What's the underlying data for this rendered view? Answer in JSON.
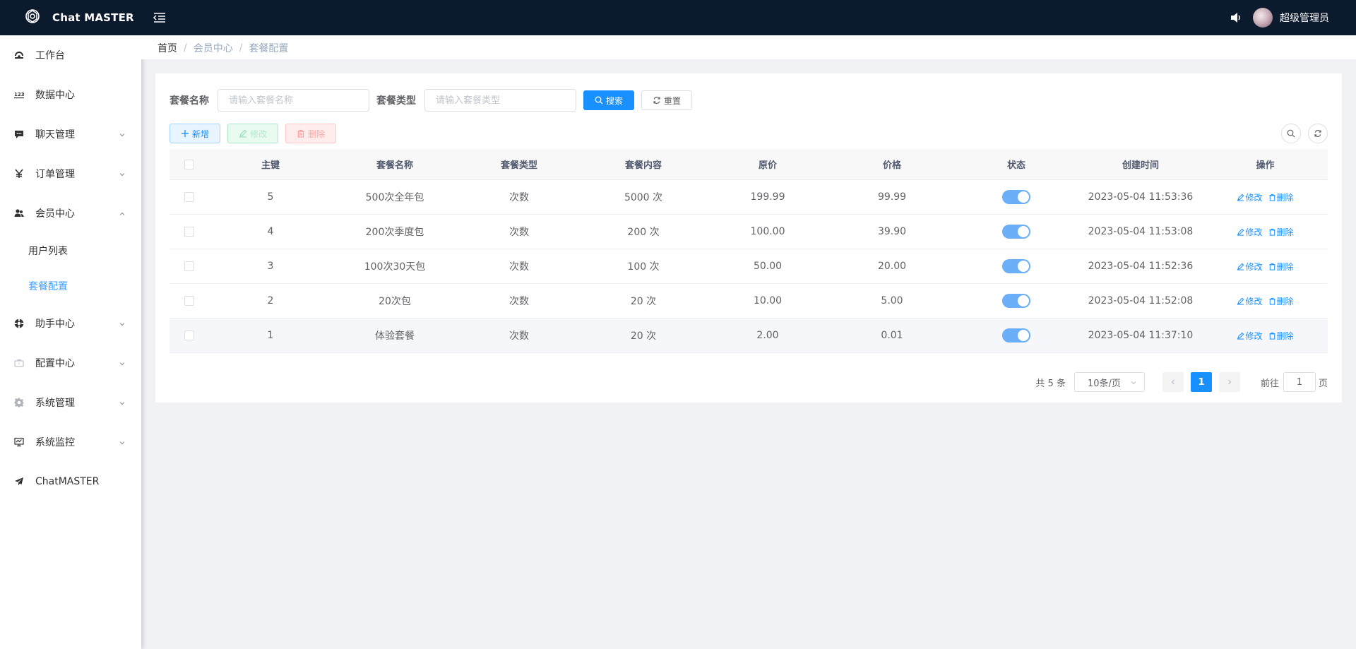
{
  "header": {
    "app_title": "Chat MASTER",
    "username": "超级管理员"
  },
  "sidebar": {
    "items": [
      {
        "label": "工作台",
        "icon": "dashboard-icon",
        "expandable": false
      },
      {
        "label": "数据中心",
        "icon": "numbers-icon",
        "expandable": false
      },
      {
        "label": "聊天管理",
        "icon": "chat-icon",
        "expandable": true
      },
      {
        "label": "订单管理",
        "icon": "yen-icon",
        "expandable": true
      },
      {
        "label": "会员中心",
        "icon": "user-group-icon",
        "expandable": true,
        "expanded": true
      },
      {
        "label": "助手中心",
        "icon": "assistant-icon",
        "expandable": true
      },
      {
        "label": "配置中心",
        "icon": "toolbox-icon",
        "expandable": true
      },
      {
        "label": "系统管理",
        "icon": "gear-icon",
        "expandable": true
      },
      {
        "label": "系统监控",
        "icon": "monitor-icon",
        "expandable": true
      },
      {
        "label": "ChatMASTER",
        "icon": "send-icon",
        "expandable": false
      }
    ],
    "sub_items": {
      "member": [
        {
          "label": "用户列表",
          "active": false
        },
        {
          "label": "套餐配置",
          "active": true
        }
      ]
    }
  },
  "breadcrumb": [
    "首页",
    "会员中心",
    "套餐配置"
  ],
  "search": {
    "name_label": "套餐名称",
    "name_placeholder": "请输入套餐名称",
    "type_label": "套餐类型",
    "type_placeholder": "请输入套餐类型",
    "search_button": "搜索",
    "reset_button": "重置"
  },
  "toolbar": {
    "add_label": "新增",
    "edit_label": "修改",
    "delete_label": "删除"
  },
  "table": {
    "columns": [
      "主键",
      "套餐名称",
      "套餐类型",
      "套餐内容",
      "原价",
      "价格",
      "状态",
      "创建时间",
      "操作"
    ],
    "rows": [
      {
        "id": "5",
        "name": "500次全年包",
        "type": "次数",
        "content": "5000 次",
        "original_price": "199.99",
        "price": "99.99",
        "status": true,
        "created": "2023-05-04 11:53:36"
      },
      {
        "id": "4",
        "name": "200次季度包",
        "type": "次数",
        "content": "200 次",
        "original_price": "100.00",
        "price": "39.90",
        "status": true,
        "created": "2023-05-04 11:53:08"
      },
      {
        "id": "3",
        "name": "100次30天包",
        "type": "次数",
        "content": "100 次",
        "original_price": "50.00",
        "price": "20.00",
        "status": true,
        "created": "2023-05-04 11:52:36"
      },
      {
        "id": "2",
        "name": "20次包",
        "type": "次数",
        "content": "20 次",
        "original_price": "10.00",
        "price": "5.00",
        "status": true,
        "created": "2023-05-04 11:52:08"
      },
      {
        "id": "1",
        "name": "体验套餐",
        "type": "次数",
        "content": "20 次",
        "original_price": "2.00",
        "price": "0.01",
        "status": true,
        "created": "2023-05-04 11:37:10"
      }
    ],
    "row_actions": {
      "edit": "修改",
      "delete": "删除"
    }
  },
  "pagination": {
    "total_text": "共 5 条",
    "page_size": "10条/页",
    "current_page": "1",
    "goto_prefix": "前往",
    "goto_value": "1",
    "goto_suffix": "页"
  },
  "colors": {
    "header_bg": "#0c1a2e",
    "primary": "#1890ff",
    "active_menu": "#409eff",
    "switch_on": "#6aaff7"
  }
}
